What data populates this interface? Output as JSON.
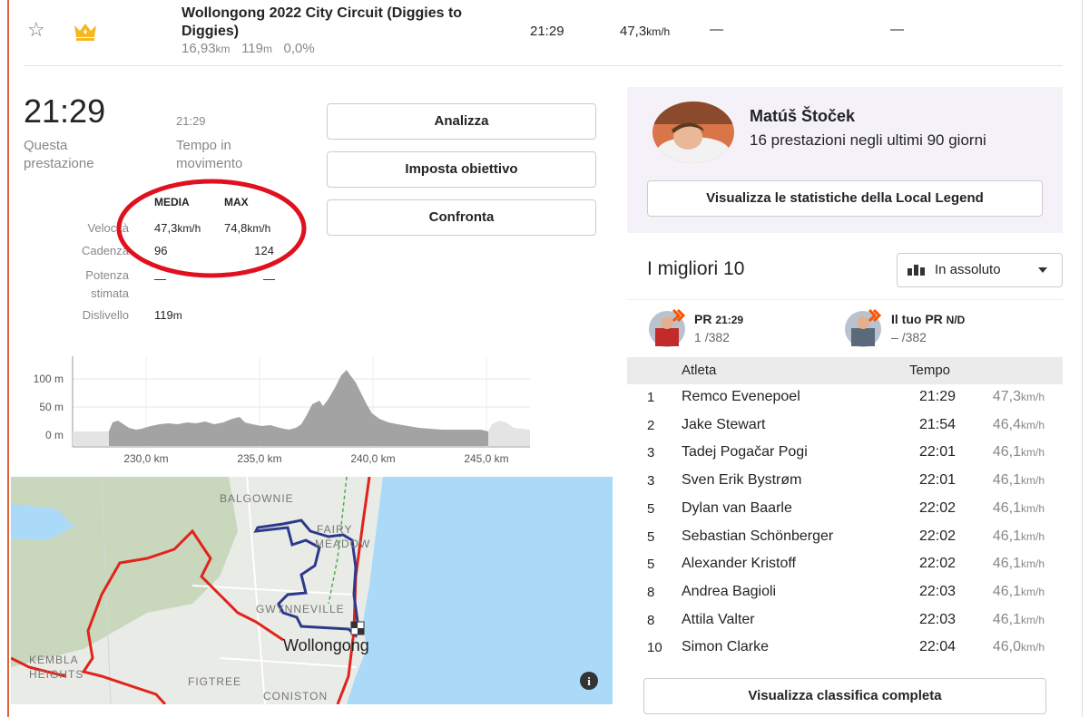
{
  "segment": {
    "name": "Wollongong 2022 City Circuit (Diggies to Diggies)",
    "distance": "16,93",
    "distance_unit": "km",
    "elevation": "119",
    "elevation_unit": "m",
    "grade": "0,0%",
    "time": "21:29",
    "speed": "47,3",
    "speed_unit": "km/h",
    "col3": "—",
    "col4": "—"
  },
  "effort": {
    "time": "21:29",
    "time_label": "Questa prestazione",
    "moving_value": "21:29",
    "moving_label": "Tempo in movimento",
    "headers": {
      "avg": "MEDIA",
      "max": "MAX"
    },
    "rows": {
      "speed": {
        "label": "Velocità",
        "avg": "47,3",
        "max": "74,8",
        "unit": "km/h"
      },
      "cadence": {
        "label": "Cadenza",
        "avg": "96",
        "max": "124"
      },
      "power": {
        "label": "Potenza stimata",
        "avg": "—",
        "max": "—"
      },
      "elevation": {
        "label": "Dislivello",
        "value": "119",
        "unit": "m"
      }
    }
  },
  "actions": {
    "analyze": "Analizza",
    "goal": "Imposta obiettivo",
    "compare": "Confronta"
  },
  "elevation_chart": {
    "y_ticks": [
      "100 m",
      "50 m",
      "0 m"
    ],
    "x_ticks": [
      "230,0 km",
      "235,0 km",
      "240,0 km",
      "245,0 km"
    ]
  },
  "map": {
    "labels": {
      "balgownie": "BALGOWNIE",
      "fairy": "FAIRY",
      "meadow": "MEADOW",
      "gwynneville": "GWYNNEVILLE",
      "wollongong": "Wollongong",
      "kembla": "KEMBLA",
      "heights": "HEIGHTS",
      "figtree": "FIGTREE",
      "coniston": "CONISTON"
    },
    "info_glyph": "i"
  },
  "local_legend": {
    "name": "Matúš Štoček",
    "count": "16 prestazioni negli ultimi 90 giorni",
    "button": "Visualizza le statistiche della Local Legend"
  },
  "leaderboard": {
    "title": "I migliori 10",
    "filter": "In assoluto",
    "pr_left": {
      "label": "PR",
      "time": "21:29",
      "rank": "1",
      "total": "/382"
    },
    "pr_right": {
      "label": "Il tuo PR",
      "time": "N/D",
      "rank": "–",
      "total": "/382"
    },
    "headers": {
      "athlete": "Atleta",
      "time": "Tempo"
    },
    "speed_unit": "km/h",
    "rows": [
      {
        "rank": "1",
        "name": "Remco Evenepoel",
        "time": "21:29",
        "speed": "47,3"
      },
      {
        "rank": "2",
        "name": "Jake Stewart",
        "time": "21:54",
        "speed": "46,4"
      },
      {
        "rank": "3",
        "name": "Tadej Pogačar Pogi",
        "time": "22:01",
        "speed": "46,1"
      },
      {
        "rank": "3",
        "name": "Sven Erik Bystrøm",
        "time": "22:01",
        "speed": "46,1"
      },
      {
        "rank": "5",
        "name": "Dylan van Baarle",
        "time": "22:02",
        "speed": "46,1"
      },
      {
        "rank": "5",
        "name": "Sebastian Schönberger",
        "time": "22:02",
        "speed": "46,1"
      },
      {
        "rank": "5",
        "name": "Alexander Kristoff",
        "time": "22:02",
        "speed": "46,1"
      },
      {
        "rank": "8",
        "name": "Andrea Bagioli",
        "time": "22:03",
        "speed": "46,1"
      },
      {
        "rank": "8",
        "name": "Attila Valter",
        "time": "22:03",
        "speed": "46,1"
      },
      {
        "rank": "10",
        "name": "Simon Clarke",
        "time": "22:04",
        "speed": "46,0"
      }
    ],
    "full_button": "Visualizza classifica completa"
  },
  "colors": {
    "accent": "#fc5200",
    "route_blue": "#2d3a8c",
    "route_red": "#e0241b",
    "annotation_red": "#e0101e",
    "legend_bg": "#f4f2f8",
    "water": "#aadaf7"
  },
  "icons": [
    "star-icon",
    "crown-icon",
    "chart-bars-icon",
    "chevron-down-icon",
    "info-icon",
    "checkered-flag-icon"
  ]
}
